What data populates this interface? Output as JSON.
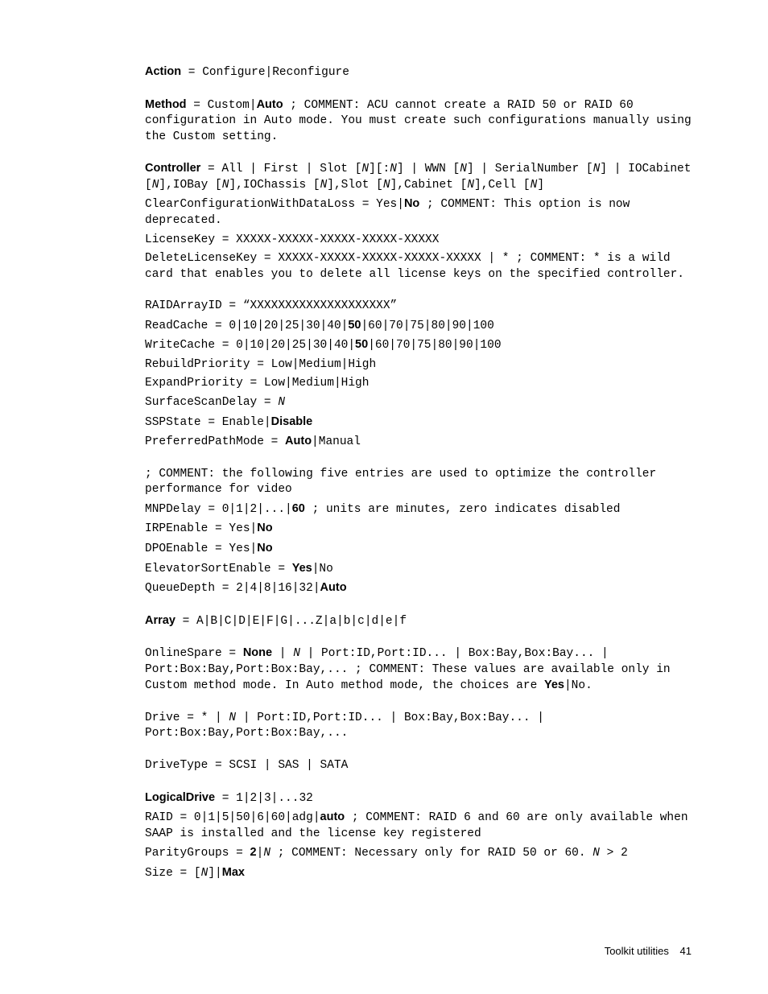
{
  "lines": [
    {
      "segs": [
        {
          "t": "Action",
          "b": true
        },
        {
          "t": " = Configure|Reconfigure"
        }
      ]
    },
    {
      "gap": true,
      "segs": [
        {
          "t": "Method",
          "b": true
        },
        {
          "t": " = Custom|"
        },
        {
          "t": "Auto",
          "b": true
        },
        {
          "t": " ; COMMENT: ACU cannot create a RAID 50 or RAID 60 configuration in Auto mode. You must create such configurations manually using the Custom setting."
        }
      ]
    },
    {
      "gap": true,
      "segs": [
        {
          "t": "Controller",
          "b": true
        },
        {
          "t": " = All | First | Slot ["
        },
        {
          "t": "N",
          "i": true
        },
        {
          "t": "][:"
        },
        {
          "t": "N",
          "i": true
        },
        {
          "t": "] | WWN ["
        },
        {
          "t": "N",
          "i": true
        },
        {
          "t": "] | SerialNumber ["
        },
        {
          "t": "N",
          "i": true
        },
        {
          "t": "] | IOCabinet ["
        },
        {
          "t": "N",
          "i": true
        },
        {
          "t": "],IOBay ["
        },
        {
          "t": "N",
          "i": true
        },
        {
          "t": "],IOChassis ["
        },
        {
          "t": "N",
          "i": true
        },
        {
          "t": "],Slot ["
        },
        {
          "t": "N",
          "i": true
        },
        {
          "t": "],Cabinet ["
        },
        {
          "t": "N",
          "i": true
        },
        {
          "t": "],Cell ["
        },
        {
          "t": "N",
          "i": true
        },
        {
          "t": "]"
        }
      ]
    },
    {
      "segs": [
        {
          "t": "ClearConfigurationWithDataLoss = Yes|"
        },
        {
          "t": "No",
          "b": true
        },
        {
          "t": " ; COMMENT: This option is now deprecated."
        }
      ]
    },
    {
      "segs": [
        {
          "t": "LicenseKey = XXXXX-XXXXX-XXXXX-XXXXX-XXXXX"
        }
      ]
    },
    {
      "segs": [
        {
          "t": "DeleteLicenseKey = XXXXX-XXXXX-XXXXX-XXXXX-XXXXX | * ; COMMENT: * is a wild card that enables you to delete all license keys on the specified controller."
        }
      ]
    },
    {
      "gap": true,
      "segs": [
        {
          "t": "RAIDArrayID = “XXXXXXXXXXXXXXXXXXXX”"
        }
      ]
    },
    {
      "segs": [
        {
          "t": "ReadCache = 0|10|20|25|30|40|"
        },
        {
          "t": "50",
          "b": true
        },
        {
          "t": "|60|70|75|80|90|100"
        }
      ]
    },
    {
      "segs": [
        {
          "t": "WriteCache = 0|10|20|25|30|40|"
        },
        {
          "t": "50",
          "b": true
        },
        {
          "t": "|60|70|75|80|90|100"
        }
      ]
    },
    {
      "segs": [
        {
          "t": "RebuildPriority = Low|Medium|High"
        }
      ]
    },
    {
      "segs": [
        {
          "t": "ExpandPriority = Low|Medium|High"
        }
      ]
    },
    {
      "segs": [
        {
          "t": "SurfaceScanDelay = "
        },
        {
          "t": "N",
          "i": true
        }
      ]
    },
    {
      "segs": [
        {
          "t": "SSPState = Enable|"
        },
        {
          "t": "Disable",
          "b": true
        }
      ]
    },
    {
      "segs": [
        {
          "t": "PreferredPathMode = "
        },
        {
          "t": "Auto",
          "b": true
        },
        {
          "t": "|Manual"
        }
      ]
    },
    {
      "gap": true,
      "segs": [
        {
          "t": "; COMMENT: the following five entries are used to optimize the controller performance for video"
        }
      ]
    },
    {
      "segs": [
        {
          "t": "MNPDelay = 0|1|2|...|"
        },
        {
          "t": "60",
          "b": true
        },
        {
          "t": " ; units are minutes, zero indicates disabled"
        }
      ]
    },
    {
      "segs": [
        {
          "t": "IRPEnable = Yes|"
        },
        {
          "t": "No",
          "b": true
        }
      ]
    },
    {
      "segs": [
        {
          "t": "DPOEnable = Yes|"
        },
        {
          "t": "No",
          "b": true
        }
      ]
    },
    {
      "segs": [
        {
          "t": "ElevatorSortEnable = "
        },
        {
          "t": "Yes",
          "b": true
        },
        {
          "t": "|No"
        }
      ]
    },
    {
      "segs": [
        {
          "t": "QueueDepth = 2|4|8|16|32|"
        },
        {
          "t": "Auto",
          "b": true
        }
      ]
    },
    {
      "gap": true,
      "segs": [
        {
          "t": "Array",
          "b": true
        },
        {
          "t": " = A|B|C|D|E|F|G|...Z|a|b|c|d|e|f"
        }
      ]
    },
    {
      "gap": true,
      "segs": [
        {
          "t": "OnlineSpare = "
        },
        {
          "t": "None",
          "b": true
        },
        {
          "t": " | "
        },
        {
          "t": "N",
          "i": true
        },
        {
          "t": " | Port:ID,Port:ID... | Box:Bay,Box:Bay... | Port:Box:Bay,Port:Box:Bay,... ; COMMENT: These values are available only in Custom method mode. In Auto method mode, the choices are "
        },
        {
          "t": "Yes",
          "b": true
        },
        {
          "t": "|No."
        }
      ]
    },
    {
      "gap": true,
      "segs": [
        {
          "t": "Drive = * | "
        },
        {
          "t": "N",
          "i": true
        },
        {
          "t": " | Port:ID,Port:ID... |  Box:Bay,Box:Bay... | Port:Box:Bay,Port:Box:Bay,..."
        }
      ]
    },
    {
      "gap": true,
      "segs": [
        {
          "t": "DriveType = SCSI | SAS | SATA"
        }
      ]
    },
    {
      "gap": true,
      "segs": [
        {
          "t": "LogicalDrive",
          "b": true
        },
        {
          "t": " = 1|2|3|...32"
        }
      ]
    },
    {
      "segs": [
        {
          "t": "RAID = 0|1|5|50|6|60|adg|"
        },
        {
          "t": "auto",
          "b": true
        },
        {
          "t": " ; COMMENT: RAID 6 and 60 are only available when SAAP is installed and the license key registered"
        }
      ]
    },
    {
      "segs": [
        {
          "t": "ParityGroups = "
        },
        {
          "t": "2",
          "b": true
        },
        {
          "t": "|"
        },
        {
          "t": "N",
          "i": true
        },
        {
          "t": " ; COMMENT: Necessary only for RAID 50 or 60. "
        },
        {
          "t": "N",
          "i": true
        },
        {
          "t": " > 2"
        }
      ]
    },
    {
      "segs": [
        {
          "t": "Size = ["
        },
        {
          "t": "N",
          "i": true
        },
        {
          "t": "]|"
        },
        {
          "t": "Max",
          "b": true
        }
      ]
    }
  ],
  "footer": {
    "label": "Toolkit utilities",
    "page": "41"
  }
}
